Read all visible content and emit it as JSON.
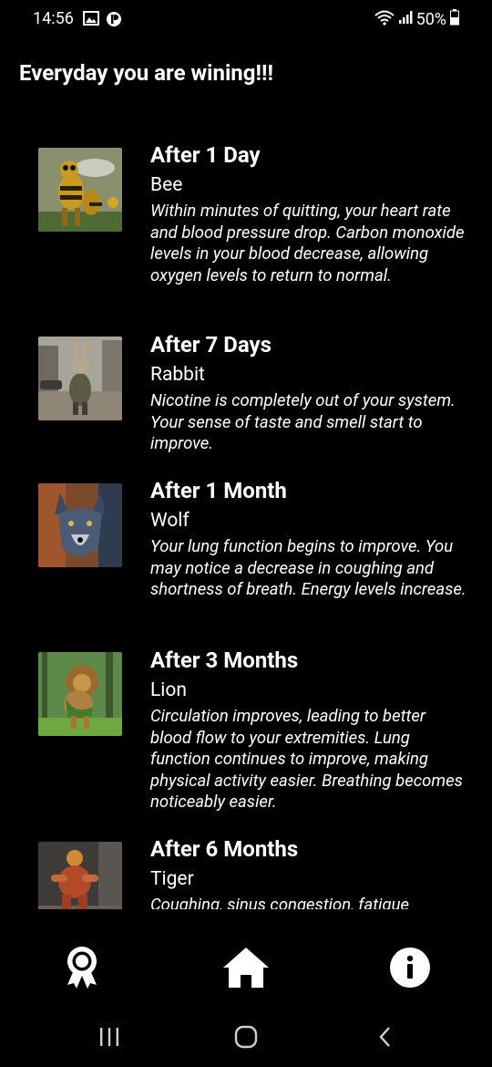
{
  "status_bar": {
    "time": "14:56",
    "battery": "50%",
    "icons": [
      "gallery-icon",
      "app-notification-icon",
      "wifi-icon",
      "signal-icon",
      "battery-icon"
    ]
  },
  "heading": "Everyday you are wining!!!",
  "milestones": [
    {
      "title": "After 1 Day",
      "animal": "Bee",
      "description": "Within minutes of quitting, your heart rate and blood pressure drop. Carbon monoxide levels in your blood decrease, allowing oxygen levels to return to normal."
    },
    {
      "title": "After 7 Days",
      "animal": "Rabbit",
      "description": "Nicotine is completely out of your system. Your sense of taste and smell start to improve."
    },
    {
      "title": "After 1 Month",
      "animal": "Wolf",
      "description": "Your lung function begins to improve. You may notice a decrease in coughing and shortness of breath. Energy levels increase."
    },
    {
      "title": "After 3 Months",
      "animal": "Lion",
      "description": "Circulation improves, leading to better blood flow to your extremities. Lung function continues to improve, making physical activity easier. Breathing becomes noticeably easier."
    },
    {
      "title": "After 6 Months",
      "animal": "Tiger",
      "description": "Coughing, sinus congestion, fatigue"
    }
  ],
  "bottom_nav": {
    "items": [
      "award-icon",
      "home-icon",
      "info-icon"
    ]
  },
  "system_nav": {
    "items": [
      "recent-apps-icon",
      "home-circle-icon",
      "back-icon"
    ]
  }
}
